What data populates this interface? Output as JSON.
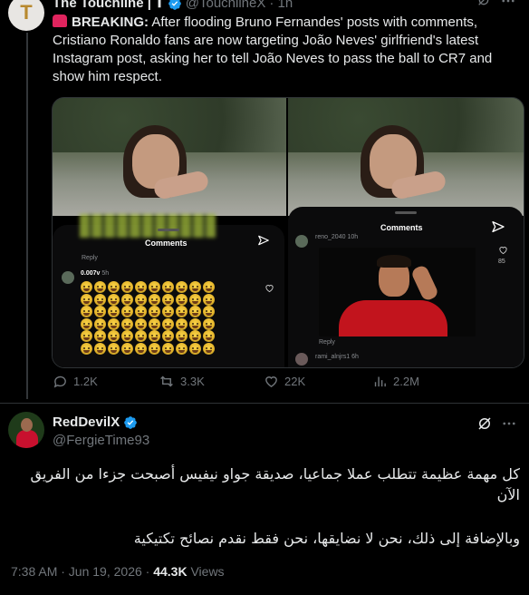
{
  "quoted_tweet": {
    "author_name": "The Touchline | 𝐓",
    "handle": "@TouchlineX",
    "time": "· 1h",
    "avatar_letter": "T",
    "body_bold": "BREAKING:",
    "body_text": "After flooding Bruno Fernandes' posts with comments, Cristiano Ronaldo fans are now targeting João Neves' girlfriend's latest Instagram post, asking her to tell João Neves to pass the ball to CR7 and show him respect.",
    "media": {
      "left": {
        "sheet_title": "Comments",
        "reply_label": "Reply",
        "comment_user": "0.007v",
        "comment_time": "5h"
      },
      "right": {
        "sheet_title": "Comments",
        "top_user": "reno_2040",
        "top_time": "10h",
        "like_count": "85",
        "reply_label": "Reply",
        "bottom_user": "rami_alnjrs1",
        "bottom_time": "6h"
      }
    },
    "actions": {
      "replies": "1.2K",
      "reposts": "3.3K",
      "likes": "22K",
      "views": "2.2M"
    }
  },
  "reply_tweet": {
    "author_name": "RedDevilX",
    "handle": "@FergieTime93",
    "line1": "كل مهمة عظيمة تتطلب عملا جماعيا، صديقة جواو نيفيس أصبحت جزءا من الفريق الآن",
    "line2": "وبالإضافة إلى ذلك، نحن لا نضايقها، نحن فقط نقدم نصائح تكتيكية",
    "timestamp": "7:38 AM · Jun 19, 2026 · ",
    "views_count": "44.3K",
    "views_label": " Views"
  },
  "colors": {
    "background": "#000000",
    "text": "#e7e9ea",
    "muted": "#71767b",
    "verified": "#1d9bf0",
    "divider": "#2f3336"
  },
  "icons": [
    "verified-badge-icon",
    "grok-icon",
    "more-icon",
    "siren-icon",
    "filter-icon",
    "heart-icon",
    "reply-icon",
    "repost-icon",
    "like-icon",
    "views-icon"
  ]
}
